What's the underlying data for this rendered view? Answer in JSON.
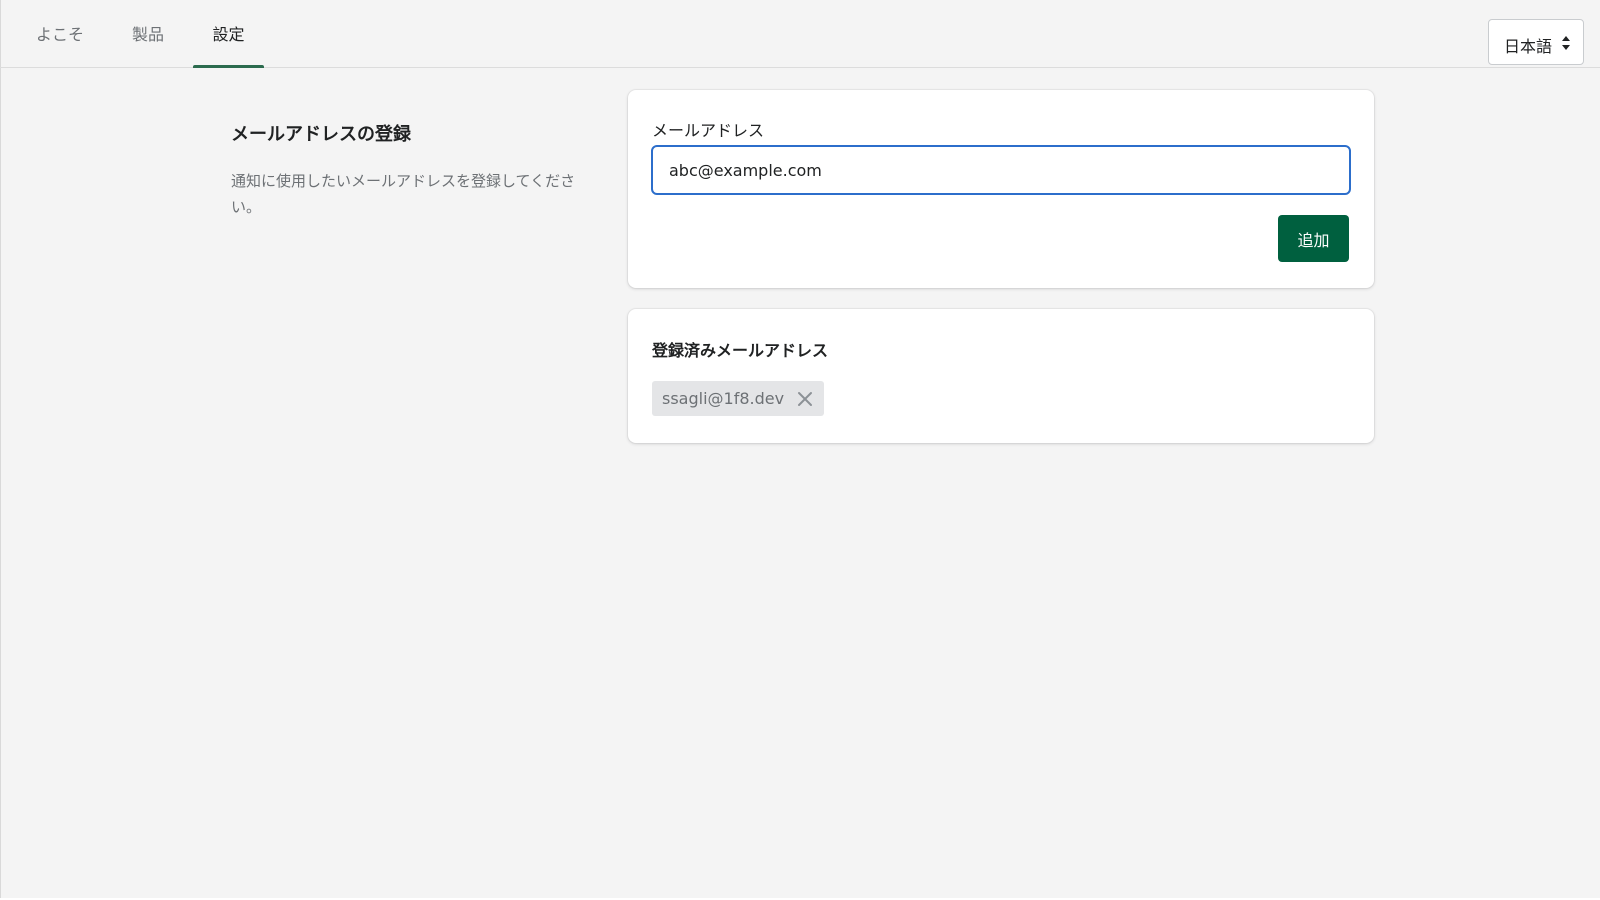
{
  "nav": {
    "tabs": [
      {
        "label": "よこそ",
        "active": false
      },
      {
        "label": "製品",
        "active": false
      },
      {
        "label": "設定",
        "active": true
      }
    ],
    "language": {
      "selected": "日本語",
      "icon": "chevron-up-down-icon"
    }
  },
  "section": {
    "title": "メールアドレスの登録",
    "description": "通知に使用したいメールアドレスを登録してください。"
  },
  "form": {
    "label": "メールアドレス",
    "input_value": "abc@example.com",
    "submit_label": "追加"
  },
  "registered": {
    "title": "登録済みメールアドレス",
    "emails": [
      "ssagli@1f8.dev"
    ],
    "remove_icon": "close-icon"
  },
  "colors": {
    "accent": "#00603f",
    "tab_underline": "#2b6b4e",
    "focus_ring": "#2c6ecb",
    "background": "#f4f4f4"
  }
}
